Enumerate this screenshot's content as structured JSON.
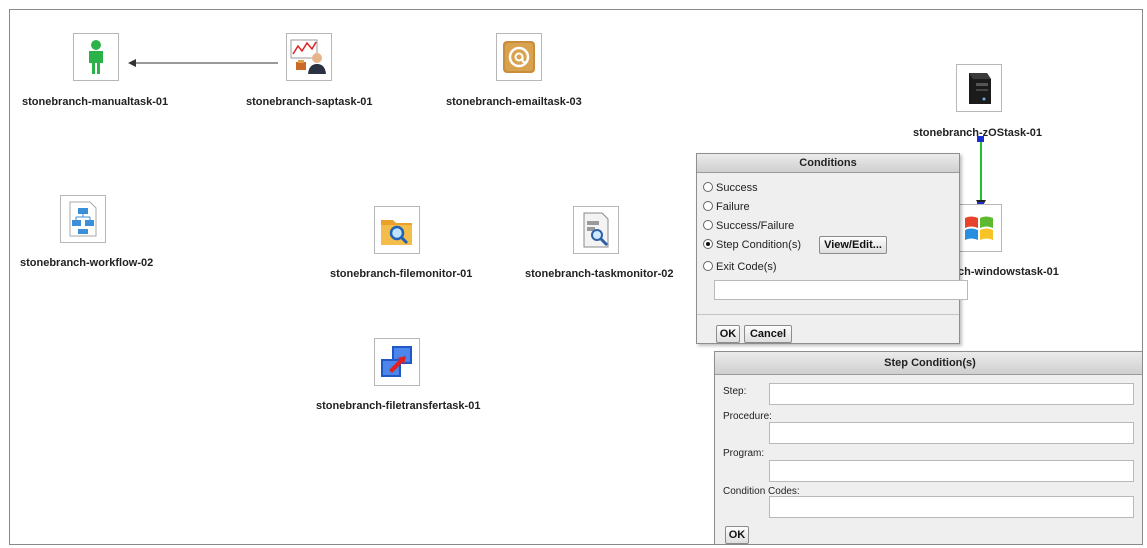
{
  "nodes": {
    "manualtask": "stonebranch-manualtask-01",
    "saptask": "stonebranch-saptask-01",
    "emailtask": "stonebranch-emailtask-03",
    "zostask": "stonebranch-zOStask-01",
    "workflow": "stonebranch-workflow-02",
    "filemonitor": "stonebranch-filemonitor-01",
    "taskmonitor": "stonebranch-taskmonitor-02",
    "windowstask_visible": "ch-windowstask-01",
    "filetransfer": "stonebranch-filetransfertask-01"
  },
  "icons": {
    "manualtask": "person-icon",
    "saptask": "sap-user-chart-icon",
    "emailtask": "email-at-icon",
    "zostask": "server-tower-icon",
    "workflow": "flowchart-icon",
    "filemonitor": "folder-search-icon",
    "taskmonitor": "document-search-icon",
    "windowstask": "windows-logo-icon",
    "filetransfer": "file-transfer-icon"
  },
  "colors": {
    "connector_green": "#22c22a",
    "connector_handle": "#1d2fd0",
    "person_green": "#2bb34a"
  },
  "conditions_dialog": {
    "title": "Conditions",
    "options": [
      {
        "label": "Success",
        "selected": false
      },
      {
        "label": "Failure",
        "selected": false
      },
      {
        "label": "Success/Failure",
        "selected": false
      },
      {
        "label": "Step Condition(s)",
        "selected": true
      },
      {
        "label": "Exit Code(s)",
        "selected": false
      }
    ],
    "view_edit_label": "View/Edit...",
    "exit_code_value": "",
    "ok_label": "OK",
    "cancel_label": "Cancel"
  },
  "step_dialog": {
    "title": "Step Condition(s)",
    "step_label": "Step:",
    "step_value": "",
    "procedure_label": "Procedure:",
    "procedure_value": "",
    "program_label": "Program:",
    "program_value": "",
    "codes_label": "Condition Codes:",
    "codes_value": "",
    "ok_label": "OK"
  }
}
